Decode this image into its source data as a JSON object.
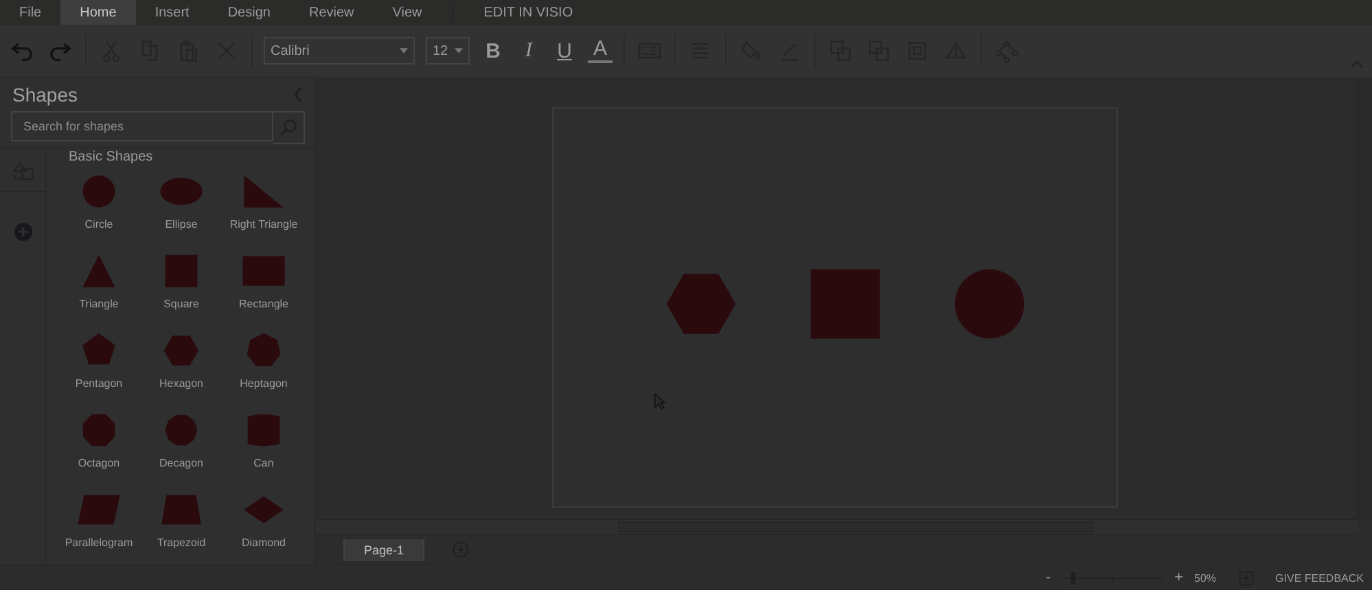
{
  "menu_tabs": [
    {
      "label": "File",
      "selected": false
    },
    {
      "label": "Home",
      "selected": true
    },
    {
      "label": "Insert",
      "selected": false
    },
    {
      "label": "Design",
      "selected": false
    },
    {
      "label": "Review",
      "selected": false
    },
    {
      "label": "View",
      "selected": false
    }
  ],
  "edit_link": "EDIT IN VISIO",
  "toolbar": {
    "font": "Calibri",
    "size": "12",
    "bold": "B",
    "italic": "I",
    "underline": "U",
    "font_color": "A"
  },
  "shapes_panel": {
    "title": "Shapes",
    "search": {
      "placeholder": "Search for shapes"
    },
    "section": "Basic Shapes",
    "shapes": [
      {
        "label": "Circle",
        "kind": "circle"
      },
      {
        "label": "Ellipse",
        "kind": "ellipse"
      },
      {
        "label": "Right Triangle",
        "kind": "right-triangle"
      },
      {
        "label": "Triangle",
        "kind": "triangle"
      },
      {
        "label": "Square",
        "kind": "square"
      },
      {
        "label": "Rectangle",
        "kind": "rectangle"
      },
      {
        "label": "Pentagon",
        "kind": "pentagon"
      },
      {
        "label": "Hexagon",
        "kind": "hexagon"
      },
      {
        "label": "Heptagon",
        "kind": "heptagon"
      },
      {
        "label": "Octagon",
        "kind": "octagon"
      },
      {
        "label": "Decagon",
        "kind": "decagon"
      },
      {
        "label": "Can",
        "kind": "can"
      },
      {
        "label": "Parallelogram",
        "kind": "parallelogram"
      },
      {
        "label": "Trapezoid",
        "kind": "trapezoid"
      },
      {
        "label": "Diamond",
        "kind": "diamond"
      }
    ]
  },
  "canvas": {
    "shapes": [
      {
        "kind": "hexagon"
      },
      {
        "kind": "square"
      },
      {
        "kind": "circle"
      }
    ]
  },
  "page_tabs": [
    {
      "label": "Page-1",
      "selected": true
    }
  ],
  "status_bar": {
    "zoom": {
      "minus": "-",
      "plus": "+",
      "level": 0.11,
      "reading": "50%"
    },
    "feedback": "GIVE FEEDBACK"
  }
}
